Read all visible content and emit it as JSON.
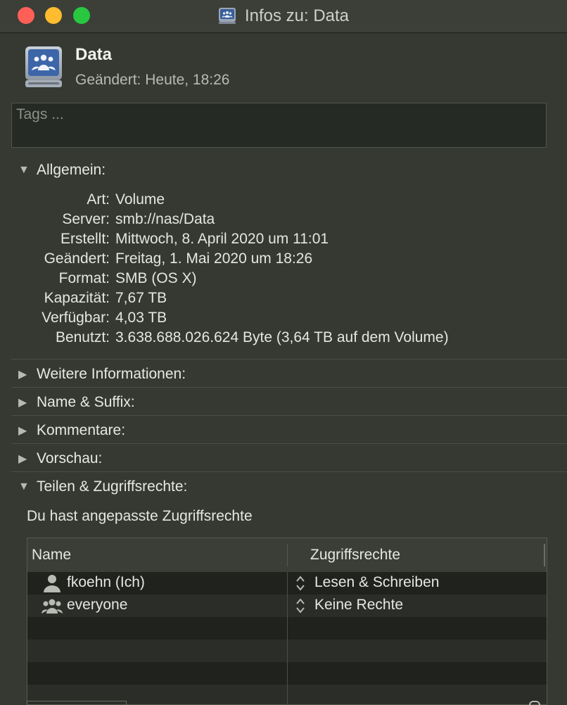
{
  "window": {
    "title": "Infos zu: Data"
  },
  "item": {
    "name": "Data",
    "modified": "Geändert: Heute, 18:26",
    "icon": "network-volume-icon"
  },
  "tags": {
    "placeholder": "Tags ..."
  },
  "general": {
    "title": "Allgemein:",
    "rows": [
      {
        "label": "Art:",
        "value": "Volume"
      },
      {
        "label": "Server:",
        "value": "smb://nas/Data"
      },
      {
        "label": "Erstellt:",
        "value": "Mittwoch, 8. April 2020 um 11:01"
      },
      {
        "label": "Geändert:",
        "value": "Freitag, 1. Mai 2020 um 18:26"
      },
      {
        "label": "Format:",
        "value": "SMB (OS X)"
      },
      {
        "label": "Kapazität:",
        "value": "7,67 TB"
      },
      {
        "label": "Verfügbar:",
        "value": "4,03 TB"
      },
      {
        "label": "Benutzt:",
        "value": "3.638.688.026.624 Byte (3,64 TB auf dem Volume)"
      }
    ]
  },
  "sections": {
    "more_info": "Weitere Informationen:",
    "name_suffix": "Name & Suffix:",
    "comments": "Kommentare:",
    "preview": "Vorschau:",
    "sharing": "Teilen & Zugriffsrechte:"
  },
  "sharing": {
    "description": "Du hast angepasste Zugriffsrechte",
    "columns": {
      "name": "Name",
      "rights": "Zugriffsrechte"
    },
    "entries": [
      {
        "name": "fkoehn (Ich)",
        "rights": "Lesen & Schreiben",
        "icon": "user-icon"
      },
      {
        "name": "everyone",
        "rights": "Keine Rechte",
        "icon": "group-icon"
      }
    ]
  },
  "colors": {
    "window_bg": "#353932",
    "close": "#fe5f57",
    "minimize": "#febc2e",
    "zoom": "#28c840"
  }
}
